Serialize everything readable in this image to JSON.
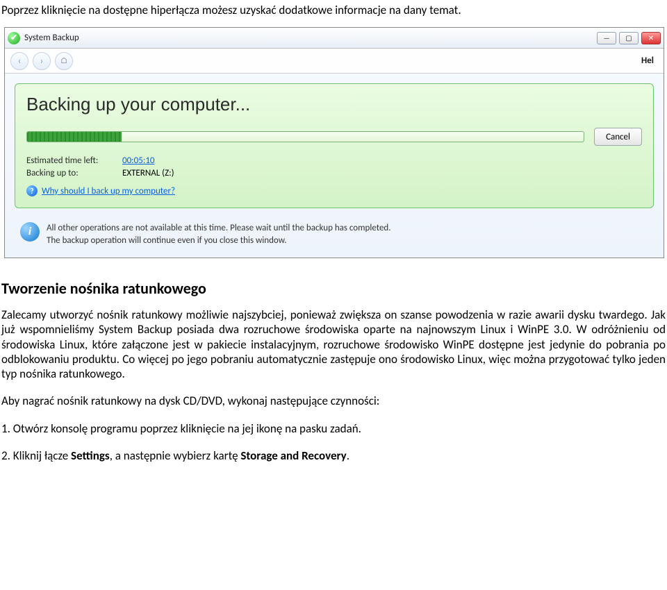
{
  "intro": "Poprzez kliknięcie na dostępne hiperłącza możesz uzyskać dodatkowe informacje na dany temat.",
  "window": {
    "title": "System Backup",
    "help": "Hel",
    "panel_title": "Backing up your computer...",
    "cancel": "Cancel",
    "est_label": "Estimated time left:",
    "est_value": "00:05:10",
    "target_label": "Backing up to:",
    "target_value": "EXTERNAL (Z:)",
    "why": "Why should I back up my computer?",
    "info_line1": "All other operations are not available at this time. Please wait until the backup has completed.",
    "info_line2": "The backup operation will continue even if you close this window."
  },
  "doc": {
    "heading": "Tworzenie nośnika ratunkowego",
    "p1": "Zalecamy utworzyć nośnik ratunkowy możliwie najszybciej, ponieważ zwiększa on szanse powodzenia w razie awarii dysku twardego. Jak już wspomnieliśmy System Backup posiada dwa rozruchowe środowiska oparte na najnowszym Linux i WinPE 3.0. W odróżnieniu od środowiska Linux, które załączone jest w pakiecie instalacyjnym, rozruchowe środowisko WinPE dostępne jest jedynie do pobrania po odblokowaniu produktu. Co więcej po jego pobraniu automatycznie zastępuje ono środowisko Linux, więc można przygotować tylko jeden typ nośnika ratunkowego.",
    "p2": "Aby nagrać nośnik ratunkowy na dysk CD/DVD, wykonaj następujące czynności:",
    "p3": "1. Otwórz konsolę programu poprzez kliknięcie na jej ikonę na pasku zadań.",
    "p4_a": "2. Kliknij łącze ",
    "p4_b": "Settings",
    "p4_c": ", a następnie wybierz kartę ",
    "p4_d": "Storage and Recovery",
    "p4_e": "."
  }
}
